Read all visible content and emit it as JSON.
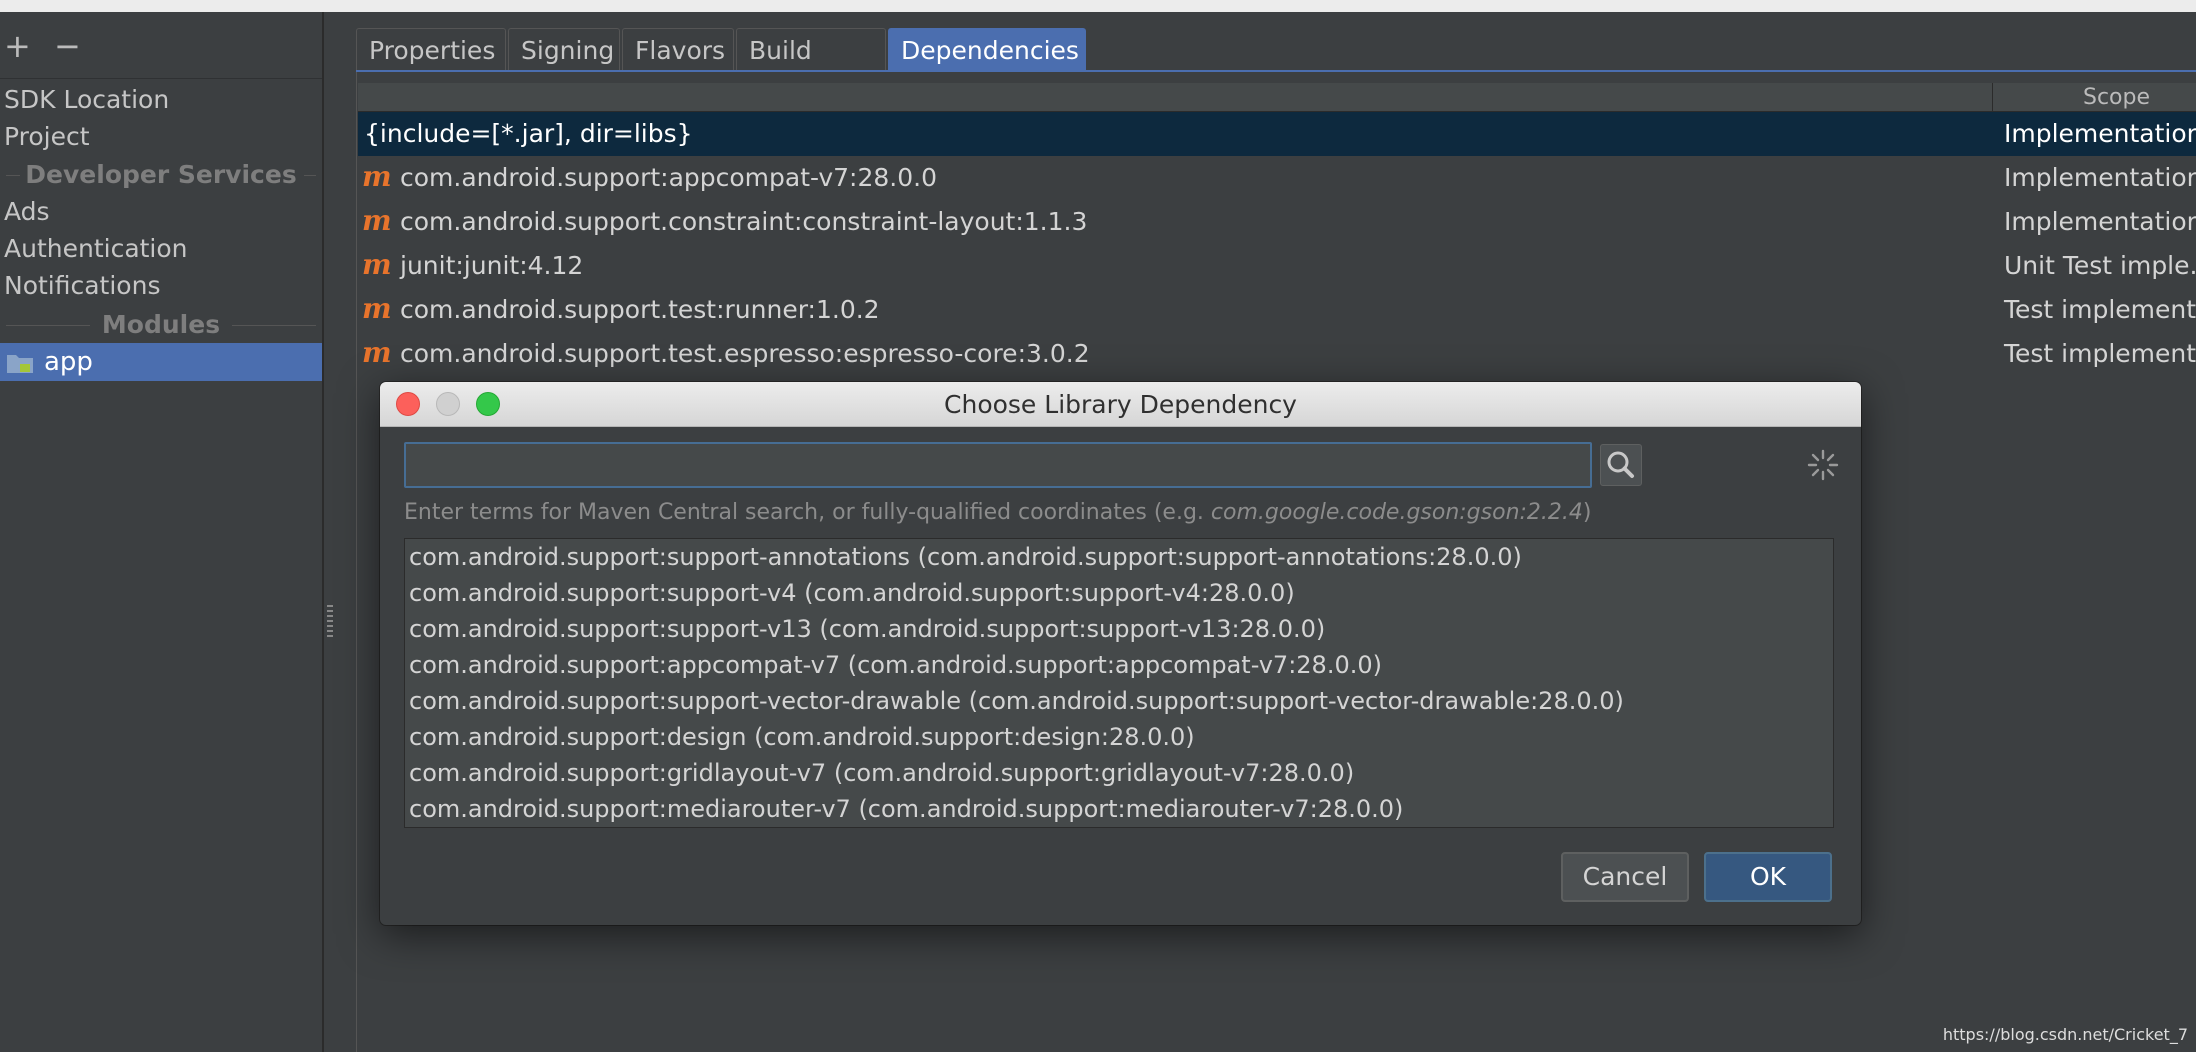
{
  "sidebar": {
    "add_label": "+",
    "remove_label": "−",
    "items": [
      "SDK Location",
      "Project"
    ],
    "developer_services_header": "Developer Services",
    "service_items": [
      "Ads",
      "Authentication",
      "Notifications"
    ],
    "modules_header": "Modules",
    "selected_module": "app"
  },
  "tabs": [
    "Properties",
    "Signing",
    "Flavors",
    "Build Types",
    "Dependencies"
  ],
  "active_tab": "Dependencies",
  "table": {
    "scope_header": "Scope",
    "rows": [
      {
        "name": "{include=[*.jar], dir=libs}",
        "scope": "Implementation",
        "maven": false
      },
      {
        "name": "com.android.support:appcompat-v7:28.0.0",
        "scope": "Implementation",
        "maven": true
      },
      {
        "name": "com.android.support.constraint:constraint-layout:1.1.3",
        "scope": "Implementation",
        "maven": true
      },
      {
        "name": "junit:junit:4.12",
        "scope": "Unit Test imple...",
        "maven": true
      },
      {
        "name": "com.android.support.test:runner:1.0.2",
        "scope": "Test implement...",
        "maven": true
      },
      {
        "name": "com.android.support.test.espresso:espresso-core:3.0.2",
        "scope": "Test implement...",
        "maven": true
      }
    ],
    "maven_icon": "m"
  },
  "dialog": {
    "title": "Choose Library Dependency",
    "search_value": "",
    "hint_prefix": "Enter terms for Maven Central search, or fully-qualified coordinates (e.g. ",
    "hint_example": "com.google.code.gson:gson:2.2.4",
    "hint_suffix": ")",
    "results": [
      "com.android.support:support-annotations (com.android.support:support-annotations:28.0.0)",
      "com.android.support:support-v4 (com.android.support:support-v4:28.0.0)",
      "com.android.support:support-v13 (com.android.support:support-v13:28.0.0)",
      "com.android.support:appcompat-v7 (com.android.support:appcompat-v7:28.0.0)",
      "com.android.support:support-vector-drawable (com.android.support:support-vector-drawable:28.0.0)",
      "com.android.support:design (com.android.support:design:28.0.0)",
      "com.android.support:gridlayout-v7 (com.android.support:gridlayout-v7:28.0.0)",
      "com.android.support:mediarouter-v7 (com.android.support:mediarouter-v7:28.0.0)"
    ],
    "cancel_label": "Cancel",
    "ok_label": "OK"
  },
  "watermark": "https://blog.csdn.net/Cricket_7",
  "colors": {
    "background": "#3c3f41",
    "selection": "#4b6eaf",
    "row_selected": "#0d293e",
    "maven_icon": "#e8742c",
    "ok_button": "#365880"
  }
}
